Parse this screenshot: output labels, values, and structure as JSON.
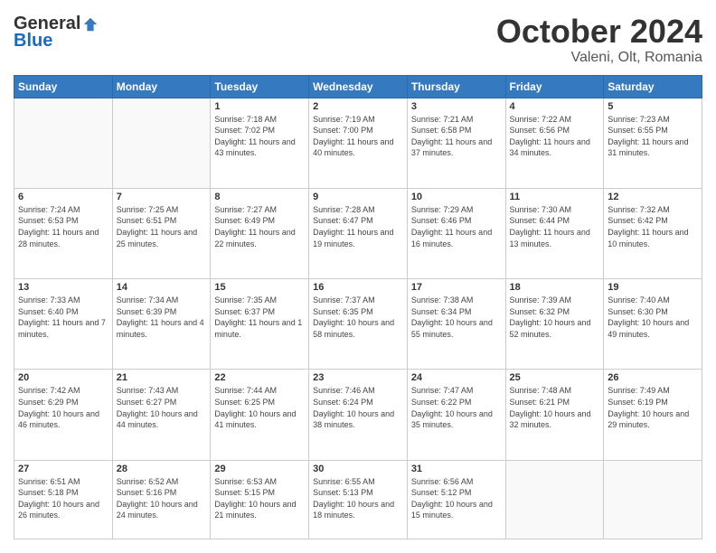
{
  "header": {
    "logo": {
      "general": "General",
      "blue": "Blue"
    },
    "title": "October 2024",
    "location": "Valeni, Olt, Romania"
  },
  "weekdays": [
    "Sunday",
    "Monday",
    "Tuesday",
    "Wednesday",
    "Thursday",
    "Friday",
    "Saturday"
  ],
  "weeks": [
    [
      {
        "day": "",
        "info": ""
      },
      {
        "day": "",
        "info": ""
      },
      {
        "day": "1",
        "info": "Sunrise: 7:18 AM\nSunset: 7:02 PM\nDaylight: 11 hours and 43 minutes."
      },
      {
        "day": "2",
        "info": "Sunrise: 7:19 AM\nSunset: 7:00 PM\nDaylight: 11 hours and 40 minutes."
      },
      {
        "day": "3",
        "info": "Sunrise: 7:21 AM\nSunset: 6:58 PM\nDaylight: 11 hours and 37 minutes."
      },
      {
        "day": "4",
        "info": "Sunrise: 7:22 AM\nSunset: 6:56 PM\nDaylight: 11 hours and 34 minutes."
      },
      {
        "day": "5",
        "info": "Sunrise: 7:23 AM\nSunset: 6:55 PM\nDaylight: 11 hours and 31 minutes."
      }
    ],
    [
      {
        "day": "6",
        "info": "Sunrise: 7:24 AM\nSunset: 6:53 PM\nDaylight: 11 hours and 28 minutes."
      },
      {
        "day": "7",
        "info": "Sunrise: 7:25 AM\nSunset: 6:51 PM\nDaylight: 11 hours and 25 minutes."
      },
      {
        "day": "8",
        "info": "Sunrise: 7:27 AM\nSunset: 6:49 PM\nDaylight: 11 hours and 22 minutes."
      },
      {
        "day": "9",
        "info": "Sunrise: 7:28 AM\nSunset: 6:47 PM\nDaylight: 11 hours and 19 minutes."
      },
      {
        "day": "10",
        "info": "Sunrise: 7:29 AM\nSunset: 6:46 PM\nDaylight: 11 hours and 16 minutes."
      },
      {
        "day": "11",
        "info": "Sunrise: 7:30 AM\nSunset: 6:44 PM\nDaylight: 11 hours and 13 minutes."
      },
      {
        "day": "12",
        "info": "Sunrise: 7:32 AM\nSunset: 6:42 PM\nDaylight: 11 hours and 10 minutes."
      }
    ],
    [
      {
        "day": "13",
        "info": "Sunrise: 7:33 AM\nSunset: 6:40 PM\nDaylight: 11 hours and 7 minutes."
      },
      {
        "day": "14",
        "info": "Sunrise: 7:34 AM\nSunset: 6:39 PM\nDaylight: 11 hours and 4 minutes."
      },
      {
        "day": "15",
        "info": "Sunrise: 7:35 AM\nSunset: 6:37 PM\nDaylight: 11 hours and 1 minute."
      },
      {
        "day": "16",
        "info": "Sunrise: 7:37 AM\nSunset: 6:35 PM\nDaylight: 10 hours and 58 minutes."
      },
      {
        "day": "17",
        "info": "Sunrise: 7:38 AM\nSunset: 6:34 PM\nDaylight: 10 hours and 55 minutes."
      },
      {
        "day": "18",
        "info": "Sunrise: 7:39 AM\nSunset: 6:32 PM\nDaylight: 10 hours and 52 minutes."
      },
      {
        "day": "19",
        "info": "Sunrise: 7:40 AM\nSunset: 6:30 PM\nDaylight: 10 hours and 49 minutes."
      }
    ],
    [
      {
        "day": "20",
        "info": "Sunrise: 7:42 AM\nSunset: 6:29 PM\nDaylight: 10 hours and 46 minutes."
      },
      {
        "day": "21",
        "info": "Sunrise: 7:43 AM\nSunset: 6:27 PM\nDaylight: 10 hours and 44 minutes."
      },
      {
        "day": "22",
        "info": "Sunrise: 7:44 AM\nSunset: 6:25 PM\nDaylight: 10 hours and 41 minutes."
      },
      {
        "day": "23",
        "info": "Sunrise: 7:46 AM\nSunset: 6:24 PM\nDaylight: 10 hours and 38 minutes."
      },
      {
        "day": "24",
        "info": "Sunrise: 7:47 AM\nSunset: 6:22 PM\nDaylight: 10 hours and 35 minutes."
      },
      {
        "day": "25",
        "info": "Sunrise: 7:48 AM\nSunset: 6:21 PM\nDaylight: 10 hours and 32 minutes."
      },
      {
        "day": "26",
        "info": "Sunrise: 7:49 AM\nSunset: 6:19 PM\nDaylight: 10 hours and 29 minutes."
      }
    ],
    [
      {
        "day": "27",
        "info": "Sunrise: 6:51 AM\nSunset: 5:18 PM\nDaylight: 10 hours and 26 minutes."
      },
      {
        "day": "28",
        "info": "Sunrise: 6:52 AM\nSunset: 5:16 PM\nDaylight: 10 hours and 24 minutes."
      },
      {
        "day": "29",
        "info": "Sunrise: 6:53 AM\nSunset: 5:15 PM\nDaylight: 10 hours and 21 minutes."
      },
      {
        "day": "30",
        "info": "Sunrise: 6:55 AM\nSunset: 5:13 PM\nDaylight: 10 hours and 18 minutes."
      },
      {
        "day": "31",
        "info": "Sunrise: 6:56 AM\nSunset: 5:12 PM\nDaylight: 10 hours and 15 minutes."
      },
      {
        "day": "",
        "info": ""
      },
      {
        "day": "",
        "info": ""
      }
    ]
  ]
}
